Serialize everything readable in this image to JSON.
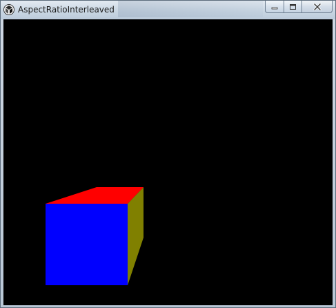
{
  "window": {
    "title": "AspectRatioInterleaved",
    "controls": {
      "minimize": "minimize",
      "maximize": "maximize",
      "close": "close"
    }
  },
  "viewport": {
    "background": "#000000"
  },
  "cube": {
    "front_color": "#0000ff",
    "top_color": "#ff0000",
    "side_color": "#808000"
  },
  "icons": {
    "app": "app-icon",
    "minimize": "minimize-icon",
    "maximize": "maximize-icon",
    "close": "close-icon"
  }
}
